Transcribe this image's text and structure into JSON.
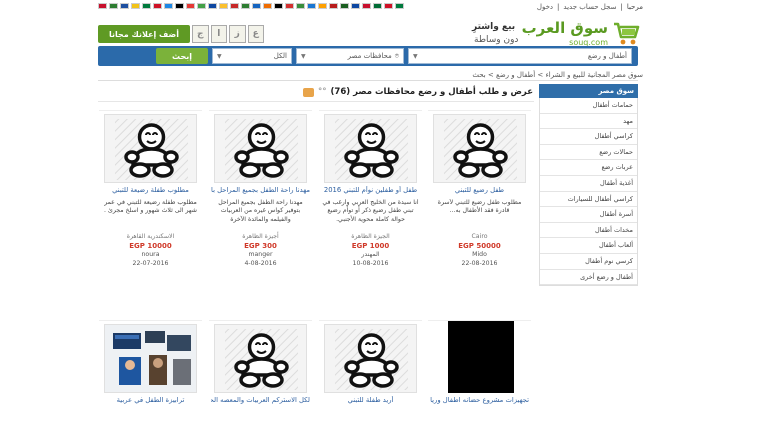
{
  "topbar": {
    "greeting": "مرحبا",
    "register": "سجل حساب جديد",
    "login": "دخول",
    "flag_colors": [
      "#c8102e",
      "#2e7d32",
      "#1d4fa0",
      "#f2c318",
      "#007a3d",
      "#ce1126",
      "#1e88e5",
      "#000000",
      "#e53935",
      "#43a047",
      "#0d47a1",
      "#fbc02d",
      "#c62828",
      "#2e7d32",
      "#1565c0",
      "#ef6c00",
      "#000000",
      "#d32f2f",
      "#388e3c",
      "#1976d2",
      "#ffa000",
      "#b71c1c",
      "#1b5e20",
      "#0d47a1",
      "#c8102e",
      "#006c35",
      "#ce1126",
      "#007a3d"
    ]
  },
  "header": {
    "brand": "سوق العرب",
    "domain": "souq.com",
    "tagline1": "بيع واشترِ",
    "tagline2": "دون وساطة",
    "ad_button": "أضف إعلانك مجانا",
    "mini_logo": [
      "ج",
      "ا",
      "ز",
      "ع"
    ]
  },
  "search": {
    "button": "إبحث",
    "category": "أطفال و رضع",
    "region": "محافظات مصر",
    "all": "الكل"
  },
  "breadcrumb": "سوق مصر المجانية للبيع و الشراء > أطفال و رضع > بحث",
  "page_title": "عرض و طلب أطفال و رضع محافظات مصر (76)",
  "sidebar": {
    "head": "سوق مصر",
    "items": [
      "حمامات أطفال",
      "مهد",
      "كراسي أطفال",
      "حمالات رضع",
      "عربات رضع",
      "أغذية أطفال",
      "كراسي أطفال للسيارات",
      "أسرة أطفال",
      "مخدات أطفال",
      "ألعاب أطفال",
      "كرسي نوم أطفال",
      "أطفال و رضع أخرى"
    ]
  },
  "listings": [
    {
      "title": "طفل رضيع للتبني",
      "desc": "مطلوب طفل رضيع للتبني لأسرة قادرة فقد الأطفال به...",
      "loc": "Cairo",
      "price": "EGP 50000",
      "user": "Mido",
      "date": "22-08-2016",
      "img": "baby"
    },
    {
      "title": "طفل أو طفلين نوأم للتبني 2016",
      "desc": "أنا سيدة من الخليج العربي وأرغب في تبني طفل رضيع ذكر أو توأم رضيع حوالة كاملة محوية الأجنبي.",
      "loc": "الجيزة الظاهرة",
      "price": "EGP 1000",
      "user": "المهندر",
      "date": "10-08-2016",
      "img": "baby"
    },
    {
      "title": "مهدنا راحة الطفل بجميع المراحل بانوراميه سيار والعربية",
      "desc": "مهدنا راحة الطفل بجميع المراحل بتوفير كواس غيره من العربيات والفيلمه والمائدة الآخرة",
      "loc": "أجيزة الظاهرة",
      "price": "EGP 300",
      "user": "manger",
      "date": "4-08-2016",
      "img": "baby"
    },
    {
      "title": "مطلوب طفلة رضيعة للتبني",
      "desc": "مطلوب طفلة رضيعة للتبني في عمر شهر الى ثلاث شهور و اسلخ مجرئ .",
      "loc": "الاسكندرية القاهرة",
      "price": "EGP 10000",
      "user": "noura",
      "date": "22-07-2016",
      "img": "baby"
    },
    {
      "title": "تجهيزات مشروع حضانه اطفال ورياض الاطفال",
      "desc": "",
      "loc": "",
      "price": "",
      "user": "",
      "date": "",
      "img": "black"
    },
    {
      "title": "أريد طفلة للتبني",
      "desc": "",
      "loc": "",
      "price": "",
      "user": "",
      "date": "",
      "img": "baby"
    },
    {
      "title": "لكل الاستركم العربيات والمعصه الحتراية الحصانية تخاطب",
      "desc": "",
      "loc": "",
      "price": "",
      "user": "",
      "date": "",
      "img": "baby"
    },
    {
      "title": "ترابيزة الطفل في عربية",
      "desc": "",
      "loc": "",
      "price": "",
      "user": "",
      "date": "",
      "img": "seat"
    }
  ]
}
